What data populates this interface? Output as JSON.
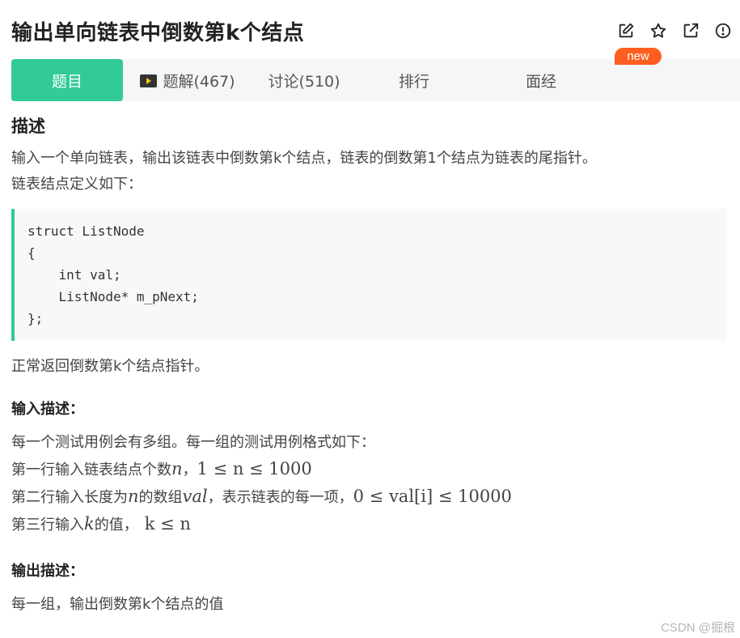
{
  "header": {
    "title": "输出单向链表中倒数第k个结点",
    "icons": [
      "edit-icon",
      "star-icon",
      "external-link-icon",
      "alert-icon"
    ]
  },
  "tabs": [
    {
      "label": "题目",
      "active": true
    },
    {
      "label": "题解(467)",
      "icon": "video-icon"
    },
    {
      "label": "讨论(510)"
    },
    {
      "label": "排行"
    },
    {
      "label": "面经"
    }
  ],
  "badge": "new",
  "description": {
    "heading": "描述",
    "line1": "输入一个单向链表，输出该链表中倒数第k个结点，链表的倒数第1个结点为链表的尾指针。",
    "line2": "链表结点定义如下：",
    "code": "struct ListNode\n{\n    int val;\n    ListNode* m_pNext;\n};",
    "line3": "正常返回倒数第k个结点指针。"
  },
  "input": {
    "heading": "输入描述：",
    "line1": "每一个测试用例会有多组。每一组的测试用例格式如下：",
    "line2_text": "第一行输入链表结点个数",
    "line2_var": "n",
    "line2_sep": "，",
    "line2_math": "1 ≤ n ≤ 1000",
    "line3_text_a": "第二行输入长度为",
    "line3_var_n": "n",
    "line3_text_b": "的数组",
    "line3_var_val": "val",
    "line3_text_c": "，表示链表的每一项，",
    "line3_math": "0 ≤ val[i] ≤ 10000",
    "line4_text": "第三行输入",
    "line4_var": "k",
    "line4_text_b": "的值，",
    "line4_math": "k ≤ n"
  },
  "output": {
    "heading": "输出描述：",
    "line1": "每一组，输出倒数第k个结点的值"
  },
  "watermark": "CSDN @掘根",
  "colors": {
    "accent": "#32ca99",
    "badge": "#fe5e20"
  }
}
